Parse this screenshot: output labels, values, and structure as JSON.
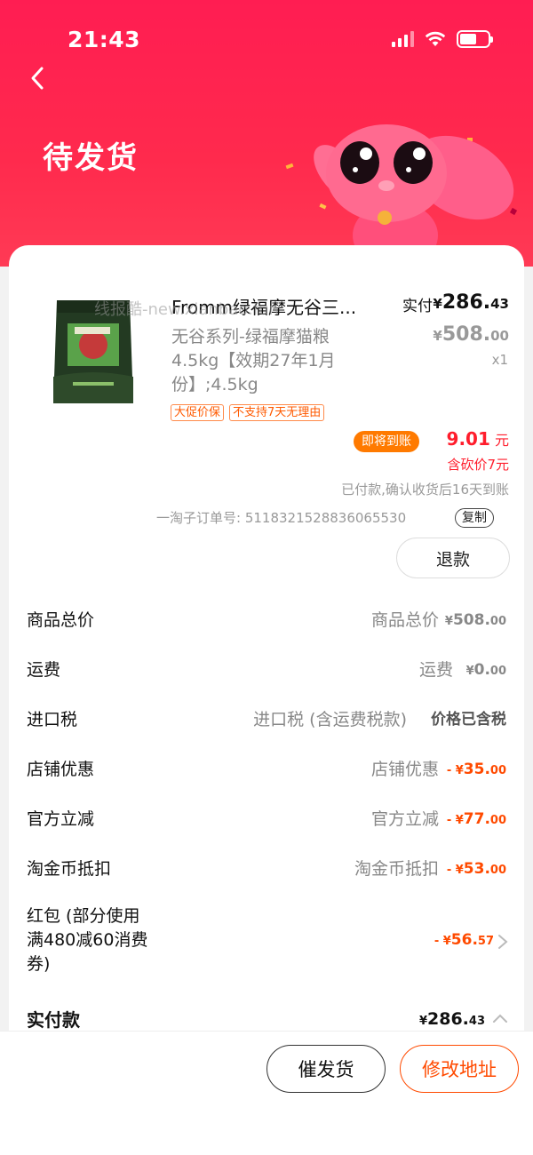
{
  "status_bar": {
    "time": "21:43"
  },
  "header": {
    "title": "待发货"
  },
  "watermark": "线报酷-new.xianbao.fun",
  "product": {
    "title": "Fromm绿福摩无谷三...",
    "spec": "无谷系列-绿福摩猫粮 4.5kg【效期27年1月份】;4.5kg",
    "tags": [
      "大促价保",
      "不支持7天无理由"
    ],
    "paid_label": "实付",
    "paid_currency": "¥",
    "paid_int": "286.",
    "paid_dec": "43",
    "orig_currency": "¥",
    "orig_int": "508.",
    "orig_dec": "00",
    "qty": "x1"
  },
  "settlement": {
    "badge": "即将到账",
    "amount": "9.01",
    "unit": " 元",
    "bargain": "含砍价7元",
    "note": "已付款,确认收货后16天到账"
  },
  "order": {
    "number_text": "一淘子订单号: 5118321528836065530",
    "copy_label": "复制",
    "refund_label": "退款"
  },
  "fees": [
    {
      "label": "商品总价",
      "desc": "商品总价",
      "prefix": "¥",
      "int": "508.",
      "dec": "00"
    },
    {
      "label": "运费",
      "desc": "运费",
      "prefix": "¥",
      "int": "0.",
      "dec": "00"
    },
    {
      "label": "进口税",
      "desc": "进口税 (含运费税款)",
      "text": "价格已含税"
    },
    {
      "label": "店铺优惠",
      "desc": "店铺优惠",
      "prefix": "- ¥",
      "int": "35.",
      "dec": "00"
    },
    {
      "label": "官方立减",
      "desc": "官方立减",
      "prefix": "- ¥",
      "int": "77.",
      "dec": "00"
    },
    {
      "label": "淘金币抵扣",
      "desc": "淘金币抵扣",
      "prefix": "- ¥",
      "int": "53.",
      "dec": "00"
    }
  ],
  "red_packet": {
    "label": "红包 (部分使用满480减60消费券)",
    "prefix": "- ¥",
    "int": "56.",
    "dec": "57"
  },
  "total": {
    "label": "实付款",
    "prefix": "¥",
    "int": "286.",
    "dec": "43"
  },
  "actions": {
    "urge_label": "催发货",
    "address_label": "修改地址"
  },
  "colors": {
    "brand_red": "#ff1d52",
    "accent_orange": "#ff4a00",
    "badge_orange": "#ff7a00"
  }
}
